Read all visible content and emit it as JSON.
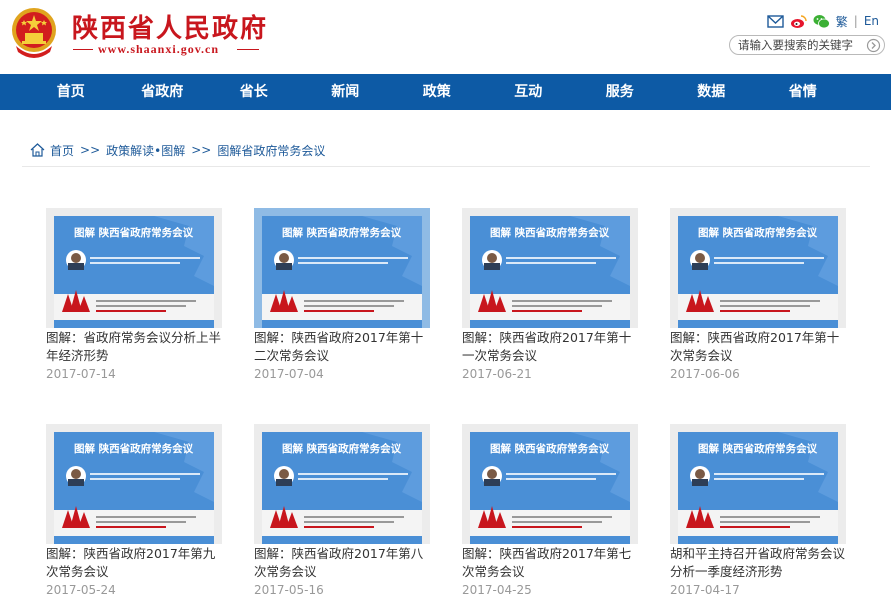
{
  "header": {
    "site_title": "陕西省人民政府",
    "site_url": "www.shaanxi.gov.cn",
    "traditional_label": "繁",
    "separator": "|",
    "english_label": "En",
    "search_placeholder": "请输入要搜索的关键字"
  },
  "nav": {
    "items": [
      "首页",
      "省政府",
      "省长",
      "新闻",
      "政策",
      "互动",
      "服务",
      "数据",
      "省情"
    ]
  },
  "breadcrumb": {
    "home": "首页",
    "sep": ">>",
    "level1": "政策解读•图解",
    "level2": "图解省政府常务会议"
  },
  "thumbnail": {
    "banner_text": "图解 陕西省政府常务会议"
  },
  "articles": [
    {
      "title": "图解：省政府常务会议分析上半年经济形势",
      "date": "2017-07-14",
      "selected": false
    },
    {
      "title": "图解：陕西省政府2017年第十二次常务会议",
      "date": "2017-07-04",
      "selected": true
    },
    {
      "title": "图解：陕西省政府2017年第十一次常务会议",
      "date": "2017-06-21",
      "selected": false
    },
    {
      "title": "图解：陕西省政府2017年第十次常务会议",
      "date": "2017-06-06",
      "selected": false
    },
    {
      "title": "图解：陕西省政府2017年第九次常务会议",
      "date": "2017-05-24",
      "selected": false
    },
    {
      "title": "图解：陕西省政府2017年第八次常务会议",
      "date": "2017-05-16",
      "selected": false
    },
    {
      "title": "图解：陕西省政府2017年第七次常务会议",
      "date": "2017-04-25",
      "selected": false
    },
    {
      "title": "胡和平主持召开省政府常务会议分析一季度经济形势",
      "date": "2017-04-17",
      "selected": false
    }
  ],
  "colors": {
    "brand_red": "#c8161d",
    "nav_blue": "#0d5aa5",
    "link_blue": "#1e5a99",
    "thumb_blue": "#4a8fd6"
  }
}
